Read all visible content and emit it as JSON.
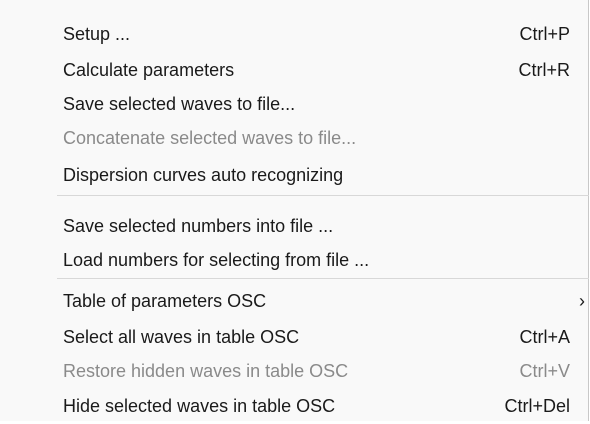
{
  "menu": {
    "items": [
      {
        "label": "Setup ...",
        "shortcut": "Ctrl+P",
        "enabled": true
      },
      {
        "label": "Calculate parameters",
        "shortcut": "Ctrl+R",
        "enabled": true
      },
      {
        "label": "Save selected waves to file...",
        "shortcut": "",
        "enabled": true
      },
      {
        "label": "Concatenate selected waves to file...",
        "shortcut": "",
        "enabled": false
      },
      {
        "label": "Dispersion curves auto recognizing",
        "shortcut": "",
        "enabled": true
      },
      {
        "label": "Save selected numbers into file ...",
        "shortcut": "",
        "enabled": true
      },
      {
        "label": "Load numbers for selecting from file ...",
        "shortcut": "",
        "enabled": true
      },
      {
        "label": "Table of parameters OSC",
        "shortcut": "",
        "enabled": true,
        "submenu_icon": "chevron-right-icon",
        "submenu_glyph": "›"
      },
      {
        "label": "Select all waves in table OSC",
        "shortcut": "Ctrl+A",
        "enabled": true
      },
      {
        "label": "Restore hidden waves in table OSC",
        "shortcut": "Ctrl+V",
        "enabled": false
      },
      {
        "label": "Hide selected waves in table OSC",
        "shortcut": "Ctrl+Del",
        "enabled": true
      }
    ]
  }
}
